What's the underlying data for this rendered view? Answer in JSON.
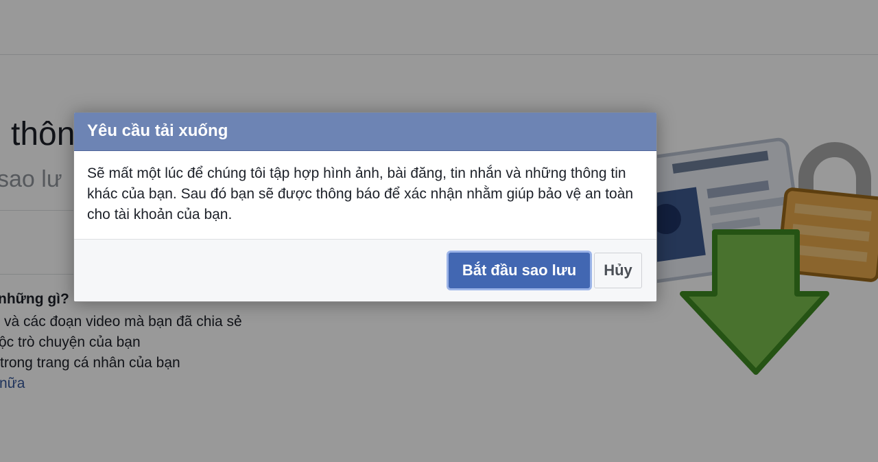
{
  "background_page": {
    "title_fragment": "thôn",
    "subtitle_fragment": "sao lư",
    "section_heading": "những gì?",
    "list_items": [
      "và các đoạn video mà bạn đã chia sẻ",
      "ộc trò chuyện của bạn",
      "trong trang cá nhân của bạn"
    ],
    "more_link": "nữa"
  },
  "dialog": {
    "title": "Yêu cầu tải xuống",
    "body": "Sẽ mất một lúc để chúng tôi tập hợp hình ảnh, bài đăng, tin nhắn và những thông tin khác của bạn. Sau đó bạn sẽ được thông báo để xác nhận nhằm giúp bảo vệ an toàn cho tài khoản của bạn.",
    "primary_button": "Bắt đầu sao lưu",
    "cancel_button": "Hủy"
  },
  "colors": {
    "dialog_header": "#6d84b4",
    "primary_button": "#4267b2",
    "link": "#365899"
  },
  "icons": [
    "id-card-icon",
    "padlock-icon",
    "download-arrow-icon"
  ]
}
